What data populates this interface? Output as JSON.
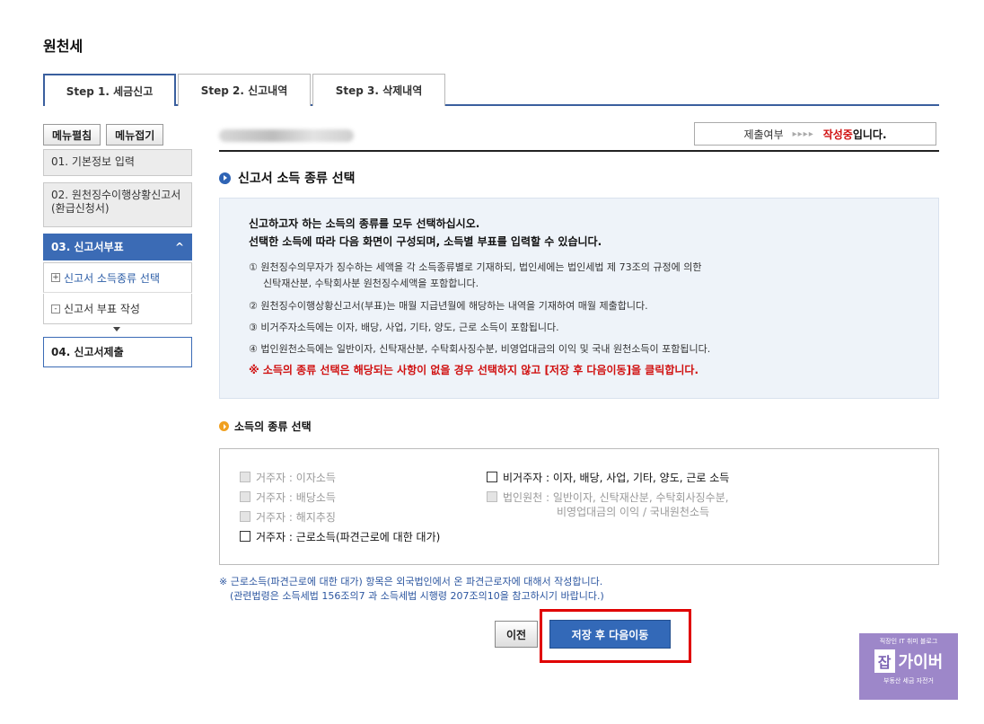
{
  "page_title": "원천세",
  "tabs": [
    {
      "label": "Step 1. 세금신고"
    },
    {
      "label": "Step 2. 신고내역"
    },
    {
      "label": "Step 3. 삭제내역"
    }
  ],
  "sidebar": {
    "expand_label": "메뉴펼침",
    "collapse_label": "메뉴접기",
    "items": [
      {
        "label": "01. 기본정보 입력"
      },
      {
        "label": "02. 원천징수이행상황신고서(환급신청서)"
      },
      {
        "label": "03. 신고서부표",
        "chevron": "^"
      },
      {
        "label": "신고서 소득종류 선택",
        "icon": "+"
      },
      {
        "label": "신고서 부표 작성",
        "icon": "-"
      },
      {
        "label": "04. 신고서제출"
      }
    ]
  },
  "status": {
    "label": "제출여부",
    "arrows": "▸▸▸▸",
    "value": "작성중",
    "suffix": "입니다."
  },
  "section_title": "신고서 소득 종류 선택",
  "info": {
    "head1": "신고하고자 하는 소득의 종류를 모두 선택하십시오.",
    "head2": "선택한 소득에 따라 다음 화면이 구성되며, 소득별 부표를 입력할 수 있습니다.",
    "line1a": "① 원천징수의무자가 징수하는 세액을 각 소득종류별로 기재하되, 법인세에는 법인세법 제 73조의 규정에 의한",
    "line1b": "신탁재산분, 수탁회사분 원천징수세액을 포함합니다.",
    "line2": "② 원천징수이행상황신고서(부표)는 매월 지급년월에 해당하는 내역을 기재하여 매월 제출합니다.",
    "line3": "③ 비거주자소득에는 이자, 배당, 사업, 기타, 양도, 근로 소득이 포함됩니다.",
    "line4": "④ 법인원천소득에는 일반이자, 신탁재산분, 수탁회사징수분, 비영업대금의 이익 및 국내 원천소득이 포함됩니다.",
    "warning": "※ 소득의 종류 선택은 해당되는 사항이 없을 경우 선택하지 않고 [저장 후 다음이동]을 클릭합니다."
  },
  "sub_title": "소득의 종류 선택",
  "checks": {
    "interest": "거주자 : 이자소득",
    "dividend": "거주자 : 배당소득",
    "termination": "거주자 : 해지추징",
    "labor": "거주자 : 근로소득(파견근로에 대한 대가)",
    "nonresident": "비거주자 : 이자, 배당, 사업, 기타, 양도, 근로 소득",
    "corp_line1": "법인원천 : 일반이자, 신탁재산분, 수탁회사징수분,",
    "corp_line2": "비영업대금의 이익 / 국내원천소득"
  },
  "note": {
    "line1": "※ 근로소득(파견근로에 대한 대가) 항목은 외국법인에서 온 파견근로자에 대해서 작성합니다.",
    "line2": "(관련법령은 소득세법 156조의7 과 소득세법 시행령 207조의10을 참고하시기 바랍니다.)"
  },
  "buttons": {
    "prev": "이전",
    "next": "저장 후 다음이동"
  },
  "logo": {
    "top": "직장인 IT 취미 블로그",
    "jab": "잡",
    "name": "가이버",
    "bottom": "부동산 세금 자전거"
  },
  "colors": {
    "accent_blue": "#3369b8",
    "warning_red": "#d01010",
    "highlight_red": "#e00000"
  }
}
